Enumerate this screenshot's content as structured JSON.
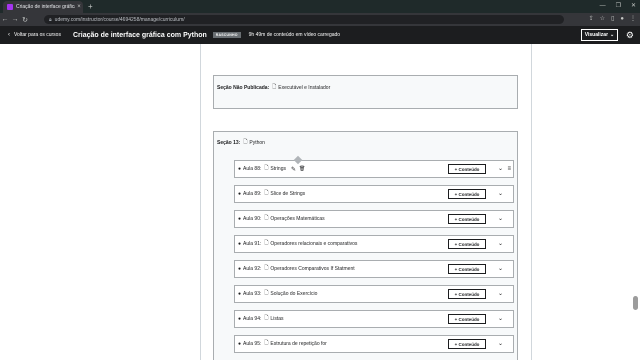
{
  "browser": {
    "tab_title": "Criação de interface gráfica com",
    "tab_close": "×",
    "new_tab": "+",
    "url": "udemy.com/instructor/course/4694258/manage/curriculum/",
    "win_min": "—",
    "win_max": "❐",
    "win_close": "✕"
  },
  "header": {
    "back_label": "Voltar para os cursos",
    "course_title": "Criação de interface gráfica com Python",
    "status_badge": "RASCUNHO",
    "uploaded_text": "9h 49m de conteúdo em vídeo carregado",
    "preview_label": "Visualizar"
  },
  "unpublished_section": {
    "label": "Seção Não Publicada:",
    "title": "Executável e Instalador"
  },
  "section13": {
    "label": "Seção 13:",
    "title": "Python"
  },
  "add_content_label": "+ Conteúdo",
  "lectures": [
    {
      "num": "Aula 88:",
      "title": "Strings"
    },
    {
      "num": "Aula 89:",
      "title": "Slice de Strings"
    },
    {
      "num": "Aula 90:",
      "title": "Operações Matemáticas"
    },
    {
      "num": "Aula 91:",
      "title": "Operadores relacionais e comparativos"
    },
    {
      "num": "Aula 92:",
      "title": "Operadores Comparativos If Statment"
    },
    {
      "num": "Aula 93:",
      "title": "Solução do Exercício"
    },
    {
      "num": "Aula 94:",
      "title": "Listas"
    },
    {
      "num": "Aula 95:",
      "title": "Estrutura de repetição for"
    }
  ]
}
